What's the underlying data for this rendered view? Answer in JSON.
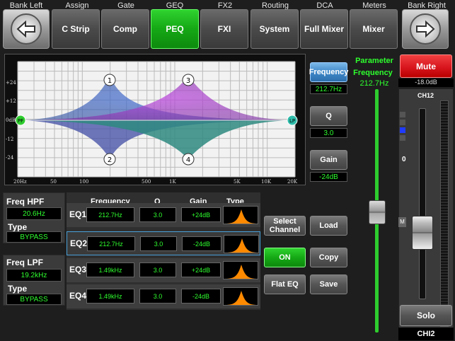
{
  "top_labels": {
    "bank_left": "Bank Left",
    "assign": "Assign",
    "gate": "Gate",
    "geq": "GEQ",
    "fx2": "FX2",
    "routing": "Routing",
    "dca": "DCA",
    "meters": "Meters",
    "bank_right": "Bank Right"
  },
  "tabs": {
    "c_strip": "C Strip",
    "comp": "Comp",
    "peq": "PEQ",
    "fxi": "FXI",
    "system": "System",
    "full_mixer": "Full Mixer",
    "mixer": "Mixer"
  },
  "graph": {
    "y_ticks": [
      "+24",
      "+12",
      "0dB",
      "-12",
      "-24"
    ],
    "x_ticks": [
      "20Hz",
      "50",
      "100",
      "500",
      "1K",
      "5K",
      "10K",
      "20K"
    ],
    "band_markers": [
      "1",
      "2",
      "3",
      "4"
    ],
    "hpf_marker": "PF",
    "lpf_marker": "LP"
  },
  "param_buttons": {
    "frequency_label": "Frequency",
    "frequency_value": "212.7Hz",
    "q_label": "Q",
    "q_value": "3.0",
    "gain_label": "Gain",
    "gain_value": "-24dB"
  },
  "parameter_panel": {
    "title": "Parameter",
    "name": "Frequency",
    "value": "212.7Hz"
  },
  "channel_strip": {
    "mute_label": "Mute",
    "gain_readout": "-18.0dB",
    "channel_name": "CH12",
    "fader_zero": "0",
    "m_label": "M",
    "solo_label": "Solo",
    "channel_footer": "CHI2"
  },
  "hpf": {
    "freq_label": "Freq HPF",
    "freq_value": "20.6Hz",
    "type_label": "Type",
    "type_value": "BYPASS"
  },
  "lpf": {
    "freq_label": "Freq LPF",
    "freq_value": "19.2kHz",
    "type_label": "Type",
    "type_value": "BYPASS"
  },
  "eq_table": {
    "headers": {
      "frequency": "Frequency",
      "q": "Q",
      "gain": "Gain",
      "type": "Type"
    },
    "rows": [
      {
        "name": "EQ1",
        "frequency": "212.7Hz",
        "q": "3.0",
        "gain": "+24dB"
      },
      {
        "name": "EQ2",
        "frequency": "212.7Hz",
        "q": "3.0",
        "gain": "-24dB"
      },
      {
        "name": "EQ3",
        "frequency": "1.49kHz",
        "q": "3.0",
        "gain": "+24dB"
      },
      {
        "name": "EQ4",
        "frequency": "1.49kHz",
        "q": "3.0",
        "gain": "-24dB"
      }
    ]
  },
  "actions": {
    "select_channel": "Select Channel",
    "load": "Load",
    "on": "ON",
    "copy": "Copy",
    "flat_eq": "Flat EQ",
    "save": "Save"
  },
  "colors": {
    "active_tab": "#15a815",
    "readout_text": "#2eff2e",
    "mute_red": "#d8161e",
    "band_blue": "#3b5fb8",
    "band_purple": "#a040c8",
    "band_teal": "#2e8a80",
    "type_orange": "#ff8a00"
  }
}
